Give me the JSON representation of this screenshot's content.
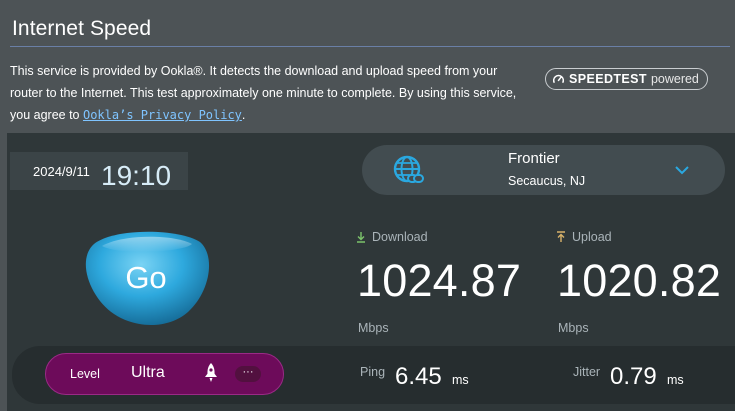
{
  "header": {
    "title": "Internet Speed"
  },
  "intro": {
    "text_before_link": "This service is provided by Ookla®. It detects the download and upload speed from your router to the Internet. This test approximately one minute to complete. By using this service, you agree to ",
    "link_text": "Ookla’s Privacy Policy",
    "text_after_link": "."
  },
  "badge": {
    "strong": "SPEEDTEST",
    "light": "powered"
  },
  "test": {
    "date": "2024/9/11",
    "time": "19:10"
  },
  "server": {
    "name": "Frontier",
    "location": "Secaucus, NJ",
    "icon": "globe-link-icon"
  },
  "go_button": {
    "label": "Go"
  },
  "download": {
    "label": "Download",
    "value": "1024.87",
    "unit": "Mbps",
    "icon": "download-arrow-icon"
  },
  "upload": {
    "label": "Upload",
    "value": "1020.82",
    "unit": "Mbps",
    "icon": "upload-arrow-icon"
  },
  "level": {
    "label": "Level",
    "value": "Ultra",
    "more": "···"
  },
  "ping": {
    "label": "Ping",
    "value": "6.45",
    "unit": "ms"
  },
  "jitter": {
    "label": "Jitter",
    "value": "0.79",
    "unit": "ms"
  },
  "colors": {
    "background": "#4d5356",
    "panel": "#2f3739",
    "accent_blue": "#2aa8e0",
    "link": "#7fc4ff",
    "level_purple": "#6d0b5a"
  }
}
